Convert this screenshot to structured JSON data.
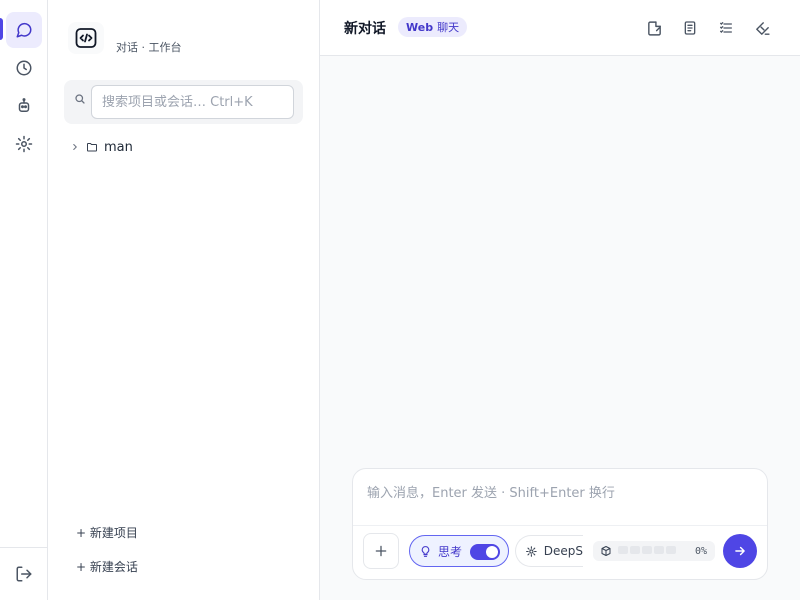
{
  "rail": {
    "items": [
      "chat-icon",
      "history-icon",
      "robot-icon",
      "settings-icon"
    ],
    "active": "chat-icon",
    "logout_icon": "logout-icon"
  },
  "sidebar": {
    "brand_subtitle": "对话 · 工作台",
    "search": {
      "placeholder": "搜索项目或会话… Ctrl+K",
      "value": ""
    },
    "tree": [
      {
        "name": "man",
        "expanded": false
      }
    ],
    "new_project_label": "+ 新建项目",
    "new_chat_label": "+ 新建会话"
  },
  "header": {
    "title": "新对话",
    "badge_prefix": "Web",
    "badge_label": "聊天",
    "actions": [
      "new-file-icon",
      "notes-icon",
      "list-settings-icon",
      "clean-icon"
    ]
  },
  "composer": {
    "placeholder": "输入消息，Enter 发送 · Shift+Enter 换行",
    "value": "",
    "think_label": "思考",
    "think_enabled": true,
    "model_label": "DeepS",
    "context_percent": "0%",
    "context_fraction": 0
  },
  "colors": {
    "accent": "#4f46e5",
    "accent_soft": "#ecebfd"
  }
}
